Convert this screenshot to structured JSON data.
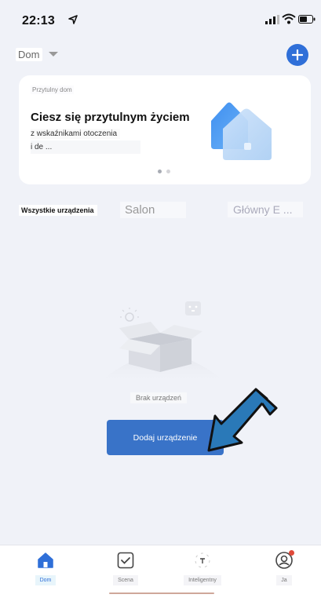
{
  "status_bar": {
    "time": "22:13",
    "location_icon": "location-arrow-icon",
    "signal_icon": "cell-signal-icon",
    "wifi_icon": "wifi-icon",
    "battery_icon": "battery-icon"
  },
  "header": {
    "home_name": "Dom",
    "dropdown_icon": "caret-down-icon",
    "add_icon": "plus-icon",
    "add_label": "+"
  },
  "banner": {
    "tag": "Przytulny dom",
    "title": "Ciesz się przytulnym życiem",
    "subtitle": "z wskaźnikami otoczenia",
    "subtitle2": "i de ...",
    "page_dots": 2,
    "active_dot": 0
  },
  "tabs": [
    {
      "label": "Wszystkie urządzenia",
      "active": true
    },
    {
      "label": "Salon",
      "active": false
    },
    {
      "label": "Główny E ...",
      "active": false
    }
  ],
  "empty_state": {
    "message": "Brak urządzeń",
    "button_label": "Dodaj urządzenie"
  },
  "bottom_nav": [
    {
      "label": "Dom",
      "icon": "home-icon",
      "active": true
    },
    {
      "label": "Scena",
      "icon": "checkbox-icon",
      "active": false
    },
    {
      "label": "Inteligentny",
      "icon": "smart-icon",
      "active": false
    },
    {
      "label": "Ja",
      "icon": "user-icon",
      "active": false,
      "badge": true
    }
  ],
  "colors": {
    "accent": "#2f6fd8",
    "button": "#3973c8",
    "background": "#f0f2f8",
    "arrow": "#2a79b8",
    "badge": "#e04a3a"
  }
}
